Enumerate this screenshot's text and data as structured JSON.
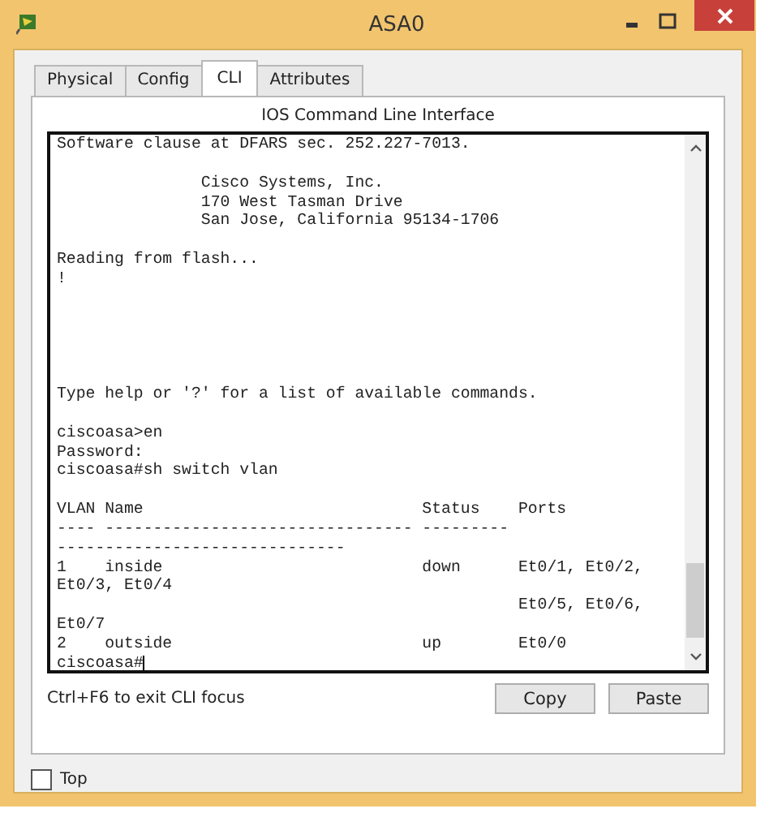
{
  "window": {
    "title": "ASA0"
  },
  "tabs": [
    {
      "label": "Physical",
      "selected": false
    },
    {
      "label": "Config",
      "selected": false
    },
    {
      "label": "CLI",
      "selected": true
    },
    {
      "label": "Attributes",
      "selected": false
    }
  ],
  "panel_title": "IOS Command Line Interface",
  "terminal": {
    "output": "Software clause at DFARS sec. 252.227-7013.\n\n               Cisco Systems, Inc.\n               170 West Tasman Drive\n               San Jose, California 95134-1706\n\nReading from flash...\n!\n\n\n\n\n\nType help or '?' for a list of available commands.\n\nciscoasa>en\nPassword:\nciscoasa#sh switch vlan\n\nVLAN Name                             Status    Ports\n---- -------------------------------- ---------\n------------------------------\n1    inside                           down      Et0/1, Et0/2,\nEt0/3, Et0/4\n                                                Et0/5, Et0/6,\nEt0/7\n2    outside                          up        Et0/0",
    "prompt": "ciscoasa#"
  },
  "hint": "Ctrl+F6 to exit CLI focus",
  "buttons": [
    "Copy",
    "Paste"
  ],
  "top_checkbox": {
    "label": "Top",
    "checked": false
  }
}
